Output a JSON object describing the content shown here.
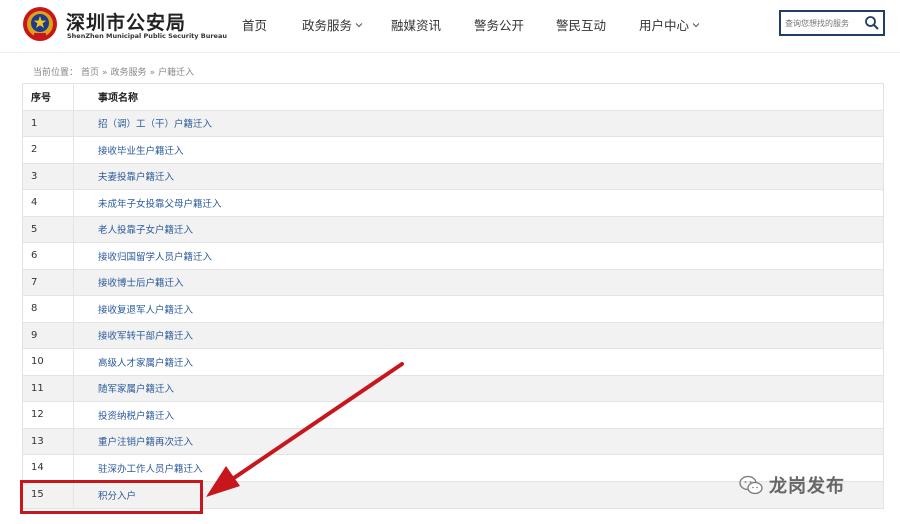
{
  "header": {
    "title_cn": "深圳市公安局",
    "title_en": "ShenZhen Municipal Public Security Bureau",
    "nav": [
      {
        "label": "首页",
        "has_dropdown": false
      },
      {
        "label": "政务服务",
        "has_dropdown": true
      },
      {
        "label": "融媒资讯",
        "has_dropdown": false
      },
      {
        "label": "警务公开",
        "has_dropdown": false
      },
      {
        "label": "警民互动",
        "has_dropdown": false
      },
      {
        "label": "用户中心",
        "has_dropdown": true
      }
    ],
    "search_placeholder": "查询您想找的服务"
  },
  "breadcrumb": {
    "prefix": "当前位置：",
    "items": [
      "首页",
      "»",
      "政务服务",
      "»",
      "户籍迁入"
    ]
  },
  "table": {
    "headers": [
      "序号",
      "事项名称"
    ],
    "rows": [
      {
        "num": "1",
        "name": "招（调）工（干）户籍迁入"
      },
      {
        "num": "2",
        "name": "接收毕业生户籍迁入"
      },
      {
        "num": "3",
        "name": "夫妻投靠户籍迁入"
      },
      {
        "num": "4",
        "name": "未成年子女投靠父母户籍迁入"
      },
      {
        "num": "5",
        "name": "老人投靠子女户籍迁入"
      },
      {
        "num": "6",
        "name": "接收归国留学人员户籍迁入"
      },
      {
        "num": "7",
        "name": "接收博士后户籍迁入"
      },
      {
        "num": "8",
        "name": "接收复退军人户籍迁入"
      },
      {
        "num": "9",
        "name": "接收军转干部户籍迁入"
      },
      {
        "num": "10",
        "name": "高级人才家属户籍迁入"
      },
      {
        "num": "11",
        "name": "随军家属户籍迁入"
      },
      {
        "num": "12",
        "name": "投资纳税户籍迁入"
      },
      {
        "num": "13",
        "name": "重户注销户籍再次迁入"
      },
      {
        "num": "14",
        "name": "驻深办工作人员户籍迁入"
      },
      {
        "num": "15",
        "name": "积分入户"
      }
    ]
  },
  "watermark": {
    "text": "龙岗发布"
  },
  "colors": {
    "annotation_red": "#c8161d",
    "link_blue": "#2a5a9b",
    "search_border": "#1f3f66"
  }
}
